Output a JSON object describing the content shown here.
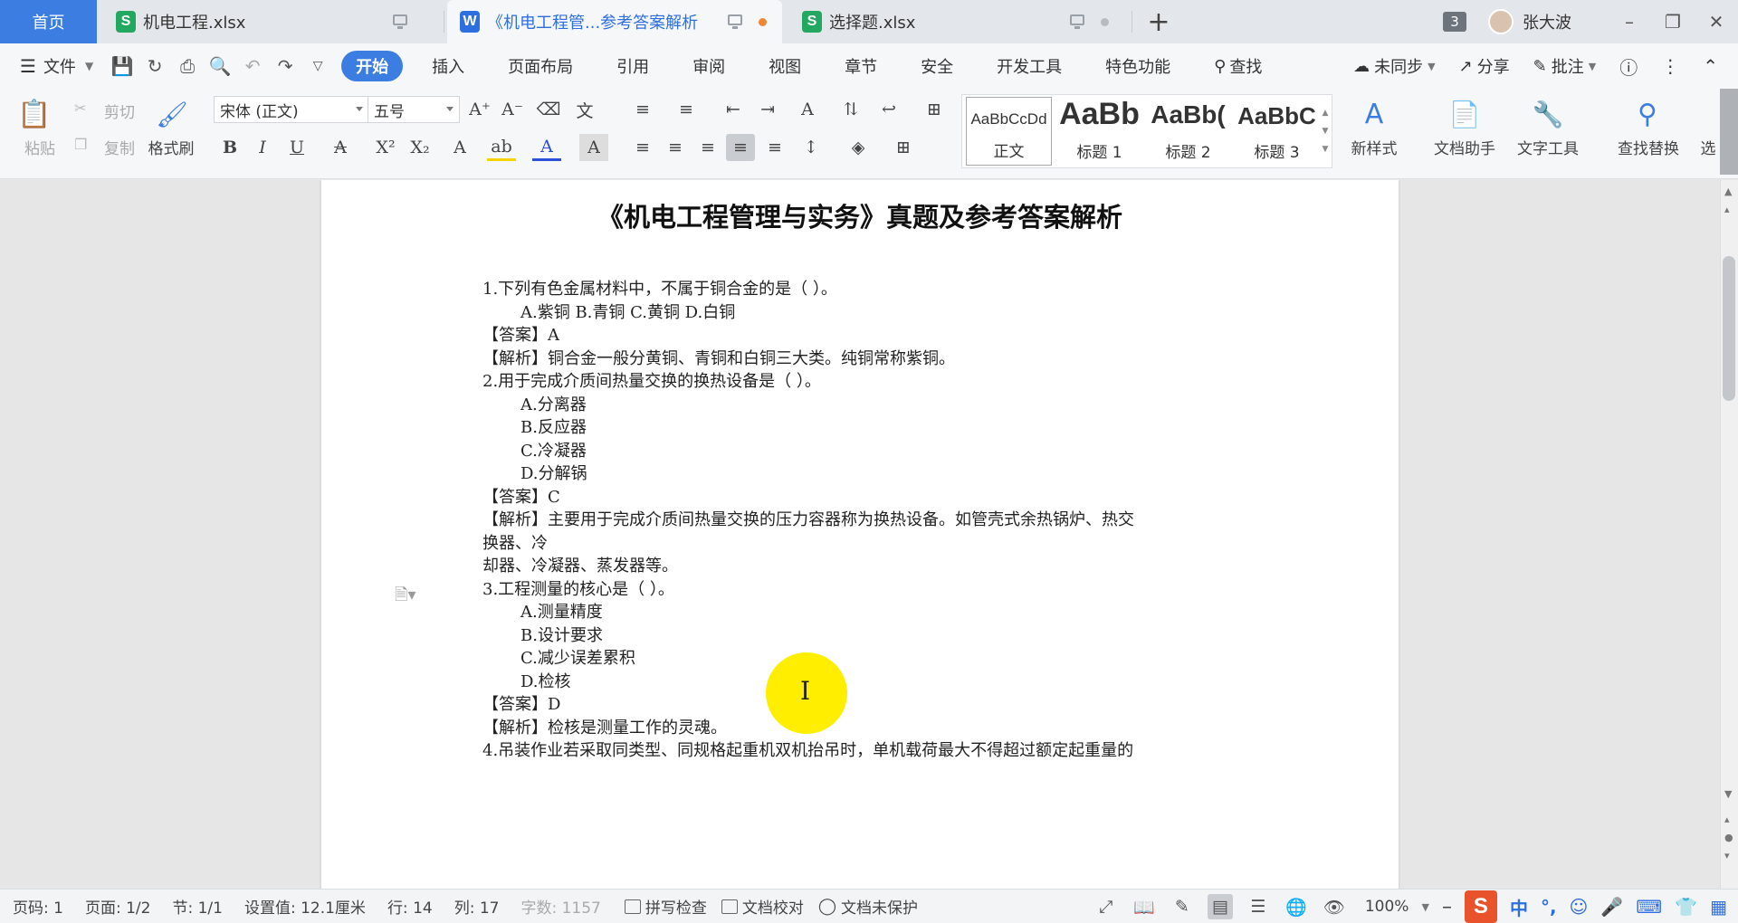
{
  "tabs": {
    "home": "首页",
    "xlsx1": "机电工程.xlsx",
    "doc": "《机电工程管...参考答案解析",
    "xlsx2": "选择题.xlsx",
    "count": "3",
    "user": "张大波"
  },
  "menu": {
    "file": "文件",
    "items": [
      "开始",
      "插入",
      "页面布局",
      "引用",
      "审阅",
      "视图",
      "章节",
      "安全",
      "开发工具",
      "特色功能"
    ],
    "search": "查找",
    "unsync": "未同步",
    "share": "分享",
    "comment": "批注"
  },
  "ribbon": {
    "paste": "粘贴",
    "cut": "剪切",
    "copy": "复制",
    "format_painter": "格式刷",
    "font_name": "宋体 (正文)",
    "font_size": "五号",
    "styles": [
      {
        "preview": "AaBbCcDd",
        "name": "正文"
      },
      {
        "preview": "AaBb",
        "name": "标题 1"
      },
      {
        "preview": "AaBb(",
        "name": "标题 2"
      },
      {
        "preview": "AaBbC",
        "name": "标题 3"
      }
    ],
    "new_style": "新样式",
    "doc_assistant": "文档助手",
    "text_tools": "文字工具",
    "find_replace": "查找替换",
    "select": "选"
  },
  "document": {
    "title": "《机电工程管理与实务》真题及参考答案解析",
    "lines": [
      {
        "text": "1.下列有色金属材料中，不属于铜合金的是（ ）。",
        "opt": false
      },
      {
        "text": "A.紫铜  B.青铜  C.黄铜  D.白铜",
        "opt": true
      },
      {
        "text": "【答案】A",
        "opt": false
      },
      {
        "text": "【解析】铜合金一般分黄铜、青铜和白铜三大类。纯铜常称紫铜。",
        "opt": false
      },
      {
        "text": "2.用于完成介质间热量交换的换热设备是（ ）。",
        "opt": false
      },
      {
        "text": "A.分离器",
        "opt": true
      },
      {
        "text": "B.反应器",
        "opt": true
      },
      {
        "text": "C.冷凝器",
        "opt": true
      },
      {
        "text": "D.分解锅",
        "opt": true
      },
      {
        "text": "【答案】C",
        "opt": false
      },
      {
        "text": "【解析】主要用于完成介质间热量交换的压力容器称为换热设备。如管壳式余热锅炉、热交",
        "opt": false
      },
      {
        "text": "换器、冷",
        "opt": false
      },
      {
        "text": "却器、冷凝器、蒸发器等。",
        "opt": false
      },
      {
        "text": "3.工程测量的核心是（ ）。",
        "opt": false
      },
      {
        "text": "A.测量精度",
        "opt": true
      },
      {
        "text": "B.设计要求",
        "opt": true
      },
      {
        "text": "C.减少误差累积",
        "opt": true
      },
      {
        "text": "D.检核",
        "opt": true
      },
      {
        "text": "【答案】D",
        "opt": false
      },
      {
        "text": "【解析】检核是测量工作的灵魂。",
        "opt": false
      },
      {
        "text": "4.吊装作业若采取同类型、同规格起重机双机抬吊时，单机载荷最大不得超过额定起重量的",
        "opt": false
      }
    ]
  },
  "status": {
    "page_no": "页码: 1",
    "pages": "页面: 1/2",
    "section": "节: 1/1",
    "setting": "设置值: 12.1厘米",
    "row": "行: 14",
    "col": "列: 17",
    "words": "字数: 1157",
    "spell": "拼写检查",
    "proof": "文档校对",
    "protect": "文档未保护",
    "zoom": "100%"
  },
  "colors": {
    "accent": "#3b7de0",
    "highlight": "#ffee00",
    "xlsx_icon": "#22a860",
    "doc_icon": "#2d6fe0"
  }
}
